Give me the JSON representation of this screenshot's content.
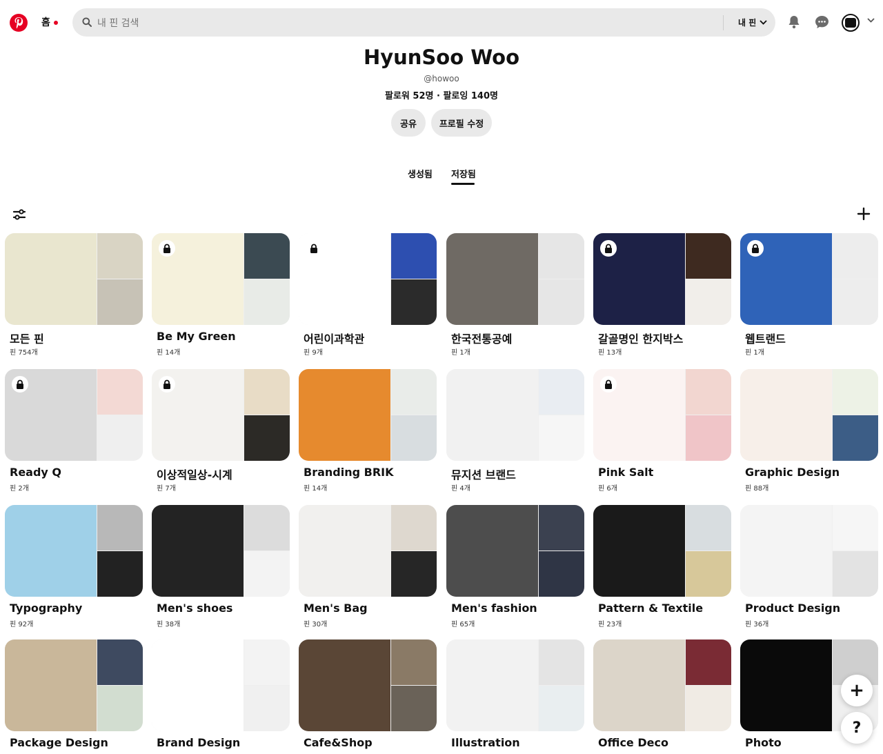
{
  "header": {
    "home_label": "홈",
    "search_placeholder": "내 핀 검색",
    "search_scope": "내 핀"
  },
  "profile": {
    "name": "HyunSoo Woo",
    "handle": "@howoo",
    "stats": "팔로워 52명 · 팔로잉 140명",
    "share_label": "공유",
    "edit_label": "프로필 수정"
  },
  "tabs": [
    {
      "label": "생성됨",
      "active": false
    },
    {
      "label": "저장됨",
      "active": true
    }
  ],
  "boards": [
    {
      "title": "모든 핀",
      "count": "핀 754개",
      "locked": false
    },
    {
      "title": "Be My Green",
      "count": "핀 14개",
      "locked": true
    },
    {
      "title": "어린이과학관",
      "count": "핀 9개",
      "locked": true
    },
    {
      "title": "한국전통공예",
      "count": "핀 1개",
      "locked": false
    },
    {
      "title": "갈골명인 한지박스",
      "count": "핀 13개",
      "locked": true
    },
    {
      "title": "웹트랜드",
      "count": "핀 1개",
      "locked": true
    },
    {
      "title": "Ready Q",
      "count": "핀 2개",
      "locked": true
    },
    {
      "title": "이상적일상-시계",
      "count": "핀 7개",
      "locked": true
    },
    {
      "title": "Branding BRIK",
      "count": "핀 14개",
      "locked": false
    },
    {
      "title": "뮤지션 브랜드",
      "count": "핀 4개",
      "locked": false
    },
    {
      "title": "Pink Salt",
      "count": "핀 6개",
      "locked": true
    },
    {
      "title": "Graphic Design",
      "count": "핀 88개",
      "locked": false
    },
    {
      "title": "Typography",
      "count": "핀 92개",
      "locked": false
    },
    {
      "title": "Men's shoes",
      "count": "핀 38개",
      "locked": false
    },
    {
      "title": "Men's Bag",
      "count": "핀 30개",
      "locked": false
    },
    {
      "title": "Men's fashion",
      "count": "핀 65개",
      "locked": false
    },
    {
      "title": "Pattern & Textile",
      "count": "핀 23개",
      "locked": false
    },
    {
      "title": "Product Design",
      "count": "핀 36개",
      "locked": false
    },
    {
      "title": "Package Design",
      "count": "",
      "locked": false
    },
    {
      "title": "Brand Design",
      "count": "",
      "locked": false
    },
    {
      "title": "Cafe&Shop",
      "count": "",
      "locked": false
    },
    {
      "title": "Illustration",
      "count": "",
      "locked": false
    },
    {
      "title": "Office Deco",
      "count": "",
      "locked": false
    },
    {
      "title": "Photo",
      "count": "",
      "locked": false
    }
  ],
  "fab": {
    "add_label": "+",
    "help_label": "?"
  },
  "colors": {
    "brand": "#e60023",
    "chip": "#e9e9e9",
    "placeholder": "#efefef"
  },
  "icons": [
    "pinterest-logo-icon",
    "search-icon",
    "chevron-down-icon",
    "bell-icon",
    "chat-icon",
    "filter-icon",
    "plus-icon",
    "lock-icon"
  ]
}
